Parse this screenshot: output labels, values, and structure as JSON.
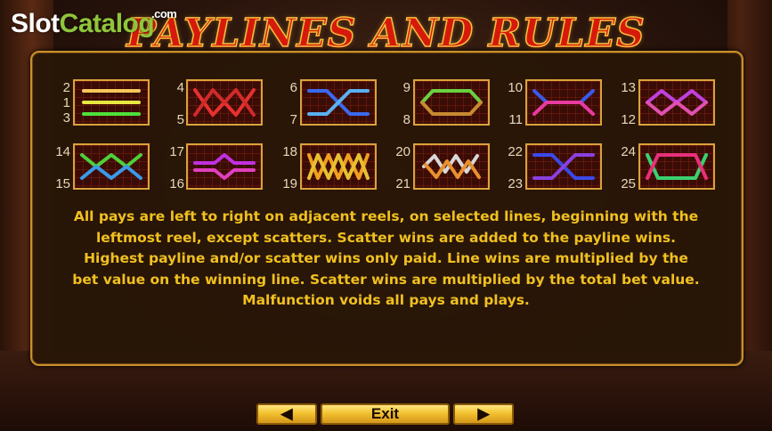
{
  "watermark": {
    "part1": "Slot",
    "part2": "Catalog",
    "part3": ".com"
  },
  "title": "PAYLINES AND RULES",
  "paylines": {
    "row1": [
      {
        "top_labels": [
          "2",
          "1",
          "3"
        ],
        "bottom_label": ""
      },
      {
        "top_labels": [
          "4"
        ],
        "bottom_label": "5"
      },
      {
        "top_labels": [
          "6"
        ],
        "bottom_label": "7"
      },
      {
        "top_labels": [
          "9"
        ],
        "bottom_label": "8"
      },
      {
        "top_labels": [
          "10"
        ],
        "bottom_label": "11"
      },
      {
        "top_labels": [
          "13"
        ],
        "bottom_label": "12"
      }
    ],
    "row2": [
      {
        "top_labels": [
          "14"
        ],
        "bottom_label": "15"
      },
      {
        "top_labels": [
          "17"
        ],
        "bottom_label": "16"
      },
      {
        "top_labels": [
          "18"
        ],
        "bottom_label": "19"
      },
      {
        "top_labels": [
          "20"
        ],
        "bottom_label": "21"
      },
      {
        "top_labels": [
          "22"
        ],
        "bottom_label": "23"
      },
      {
        "top_labels": [
          "24"
        ],
        "bottom_label": "25"
      }
    ]
  },
  "rules": {
    "line1": "All pays are left to right on adjacent reels, on selected lines, beginning with the",
    "line2": "leftmost reel, except scatters. Scatter wins are added to the payline wins.",
    "line3": "Highest payline and/or scatter wins only paid. Line wins are multiplied by the",
    "line4": "bet value on the winning line. Scatter wins are multiplied by the total bet value.",
    "line5": "Malfunction voids all pays and plays."
  },
  "nav": {
    "prev": "◀",
    "exit": "Exit",
    "next": "▶"
  },
  "colors": {
    "rules_text": "#f0c020",
    "panel_border": "#c8902a",
    "title": "#d61a0a"
  }
}
